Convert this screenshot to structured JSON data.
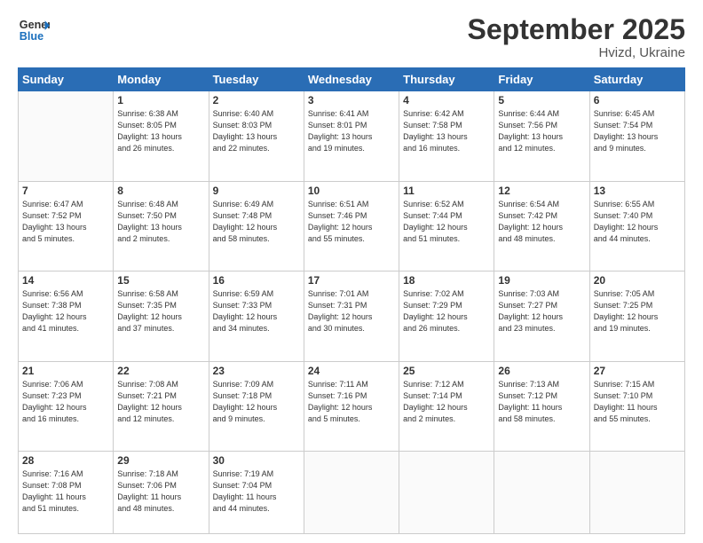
{
  "header": {
    "logo_line1": "General",
    "logo_line2": "Blue",
    "title": "September 2025",
    "subtitle": "Hvizd, Ukraine"
  },
  "weekdays": [
    "Sunday",
    "Monday",
    "Tuesday",
    "Wednesday",
    "Thursday",
    "Friday",
    "Saturday"
  ],
  "weeks": [
    [
      {
        "day": "",
        "info": ""
      },
      {
        "day": "1",
        "info": "Sunrise: 6:38 AM\nSunset: 8:05 PM\nDaylight: 13 hours\nand 26 minutes."
      },
      {
        "day": "2",
        "info": "Sunrise: 6:40 AM\nSunset: 8:03 PM\nDaylight: 13 hours\nand 22 minutes."
      },
      {
        "day": "3",
        "info": "Sunrise: 6:41 AM\nSunset: 8:01 PM\nDaylight: 13 hours\nand 19 minutes."
      },
      {
        "day": "4",
        "info": "Sunrise: 6:42 AM\nSunset: 7:58 PM\nDaylight: 13 hours\nand 16 minutes."
      },
      {
        "day": "5",
        "info": "Sunrise: 6:44 AM\nSunset: 7:56 PM\nDaylight: 13 hours\nand 12 minutes."
      },
      {
        "day": "6",
        "info": "Sunrise: 6:45 AM\nSunset: 7:54 PM\nDaylight: 13 hours\nand 9 minutes."
      }
    ],
    [
      {
        "day": "7",
        "info": "Sunrise: 6:47 AM\nSunset: 7:52 PM\nDaylight: 13 hours\nand 5 minutes."
      },
      {
        "day": "8",
        "info": "Sunrise: 6:48 AM\nSunset: 7:50 PM\nDaylight: 13 hours\nand 2 minutes."
      },
      {
        "day": "9",
        "info": "Sunrise: 6:49 AM\nSunset: 7:48 PM\nDaylight: 12 hours\nand 58 minutes."
      },
      {
        "day": "10",
        "info": "Sunrise: 6:51 AM\nSunset: 7:46 PM\nDaylight: 12 hours\nand 55 minutes."
      },
      {
        "day": "11",
        "info": "Sunrise: 6:52 AM\nSunset: 7:44 PM\nDaylight: 12 hours\nand 51 minutes."
      },
      {
        "day": "12",
        "info": "Sunrise: 6:54 AM\nSunset: 7:42 PM\nDaylight: 12 hours\nand 48 minutes."
      },
      {
        "day": "13",
        "info": "Sunrise: 6:55 AM\nSunset: 7:40 PM\nDaylight: 12 hours\nand 44 minutes."
      }
    ],
    [
      {
        "day": "14",
        "info": "Sunrise: 6:56 AM\nSunset: 7:38 PM\nDaylight: 12 hours\nand 41 minutes."
      },
      {
        "day": "15",
        "info": "Sunrise: 6:58 AM\nSunset: 7:35 PM\nDaylight: 12 hours\nand 37 minutes."
      },
      {
        "day": "16",
        "info": "Sunrise: 6:59 AM\nSunset: 7:33 PM\nDaylight: 12 hours\nand 34 minutes."
      },
      {
        "day": "17",
        "info": "Sunrise: 7:01 AM\nSunset: 7:31 PM\nDaylight: 12 hours\nand 30 minutes."
      },
      {
        "day": "18",
        "info": "Sunrise: 7:02 AM\nSunset: 7:29 PM\nDaylight: 12 hours\nand 26 minutes."
      },
      {
        "day": "19",
        "info": "Sunrise: 7:03 AM\nSunset: 7:27 PM\nDaylight: 12 hours\nand 23 minutes."
      },
      {
        "day": "20",
        "info": "Sunrise: 7:05 AM\nSunset: 7:25 PM\nDaylight: 12 hours\nand 19 minutes."
      }
    ],
    [
      {
        "day": "21",
        "info": "Sunrise: 7:06 AM\nSunset: 7:23 PM\nDaylight: 12 hours\nand 16 minutes."
      },
      {
        "day": "22",
        "info": "Sunrise: 7:08 AM\nSunset: 7:21 PM\nDaylight: 12 hours\nand 12 minutes."
      },
      {
        "day": "23",
        "info": "Sunrise: 7:09 AM\nSunset: 7:18 PM\nDaylight: 12 hours\nand 9 minutes."
      },
      {
        "day": "24",
        "info": "Sunrise: 7:11 AM\nSunset: 7:16 PM\nDaylight: 12 hours\nand 5 minutes."
      },
      {
        "day": "25",
        "info": "Sunrise: 7:12 AM\nSunset: 7:14 PM\nDaylight: 12 hours\nand 2 minutes."
      },
      {
        "day": "26",
        "info": "Sunrise: 7:13 AM\nSunset: 7:12 PM\nDaylight: 11 hours\nand 58 minutes."
      },
      {
        "day": "27",
        "info": "Sunrise: 7:15 AM\nSunset: 7:10 PM\nDaylight: 11 hours\nand 55 minutes."
      }
    ],
    [
      {
        "day": "28",
        "info": "Sunrise: 7:16 AM\nSunset: 7:08 PM\nDaylight: 11 hours\nand 51 minutes."
      },
      {
        "day": "29",
        "info": "Sunrise: 7:18 AM\nSunset: 7:06 PM\nDaylight: 11 hours\nand 48 minutes."
      },
      {
        "day": "30",
        "info": "Sunrise: 7:19 AM\nSunset: 7:04 PM\nDaylight: 11 hours\nand 44 minutes."
      },
      {
        "day": "",
        "info": ""
      },
      {
        "day": "",
        "info": ""
      },
      {
        "day": "",
        "info": ""
      },
      {
        "day": "",
        "info": ""
      }
    ]
  ]
}
